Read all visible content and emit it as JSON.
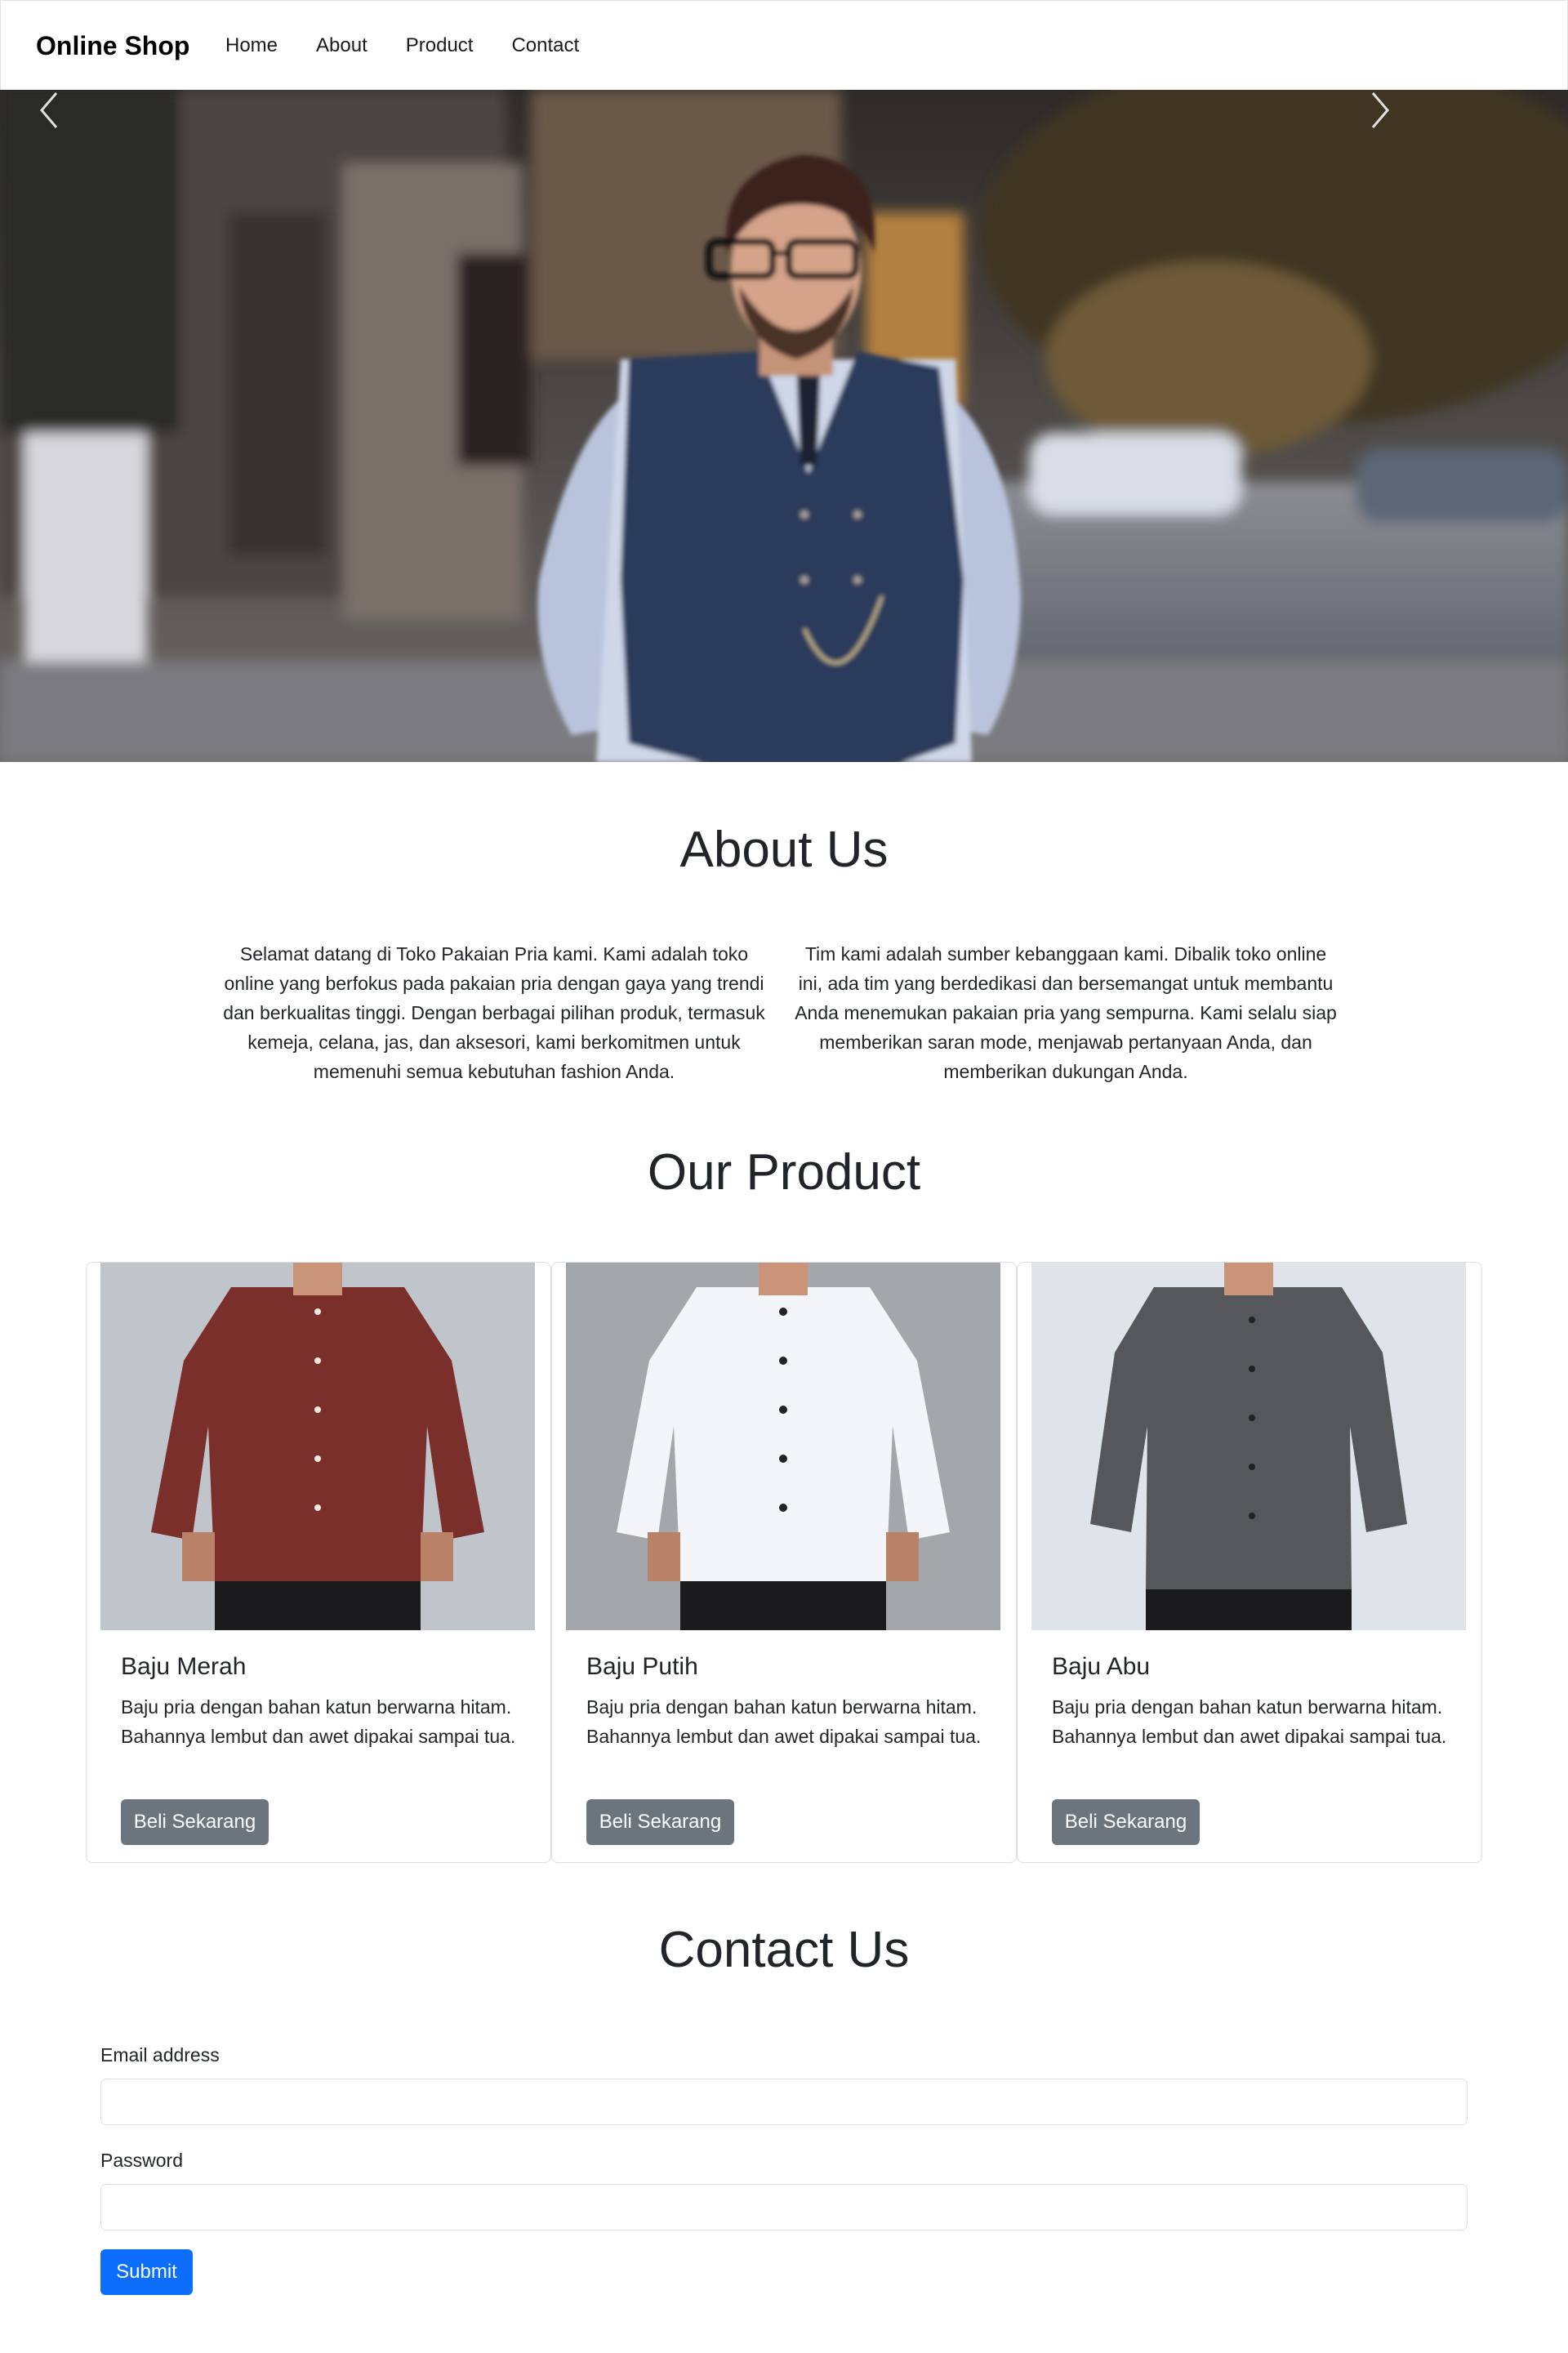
{
  "navbar": {
    "brand": "Online Shop",
    "links": [
      "Home",
      "About",
      "Product",
      "Contact"
    ]
  },
  "hero": {
    "image": "man-in-vest-street-photo",
    "prev_icon": "chevron-left-icon",
    "next_icon": "chevron-right-icon"
  },
  "about": {
    "title": "About Us",
    "paragraph_left": "Selamat datang di Toko Pakaian Pria kami. Kami adalah toko online yang berfokus pada pakaian pria dengan gaya yang trendi dan berkualitas tinggi. Dengan berbagai pilihan produk, termasuk kemeja, celana, jas, dan aksesori, kami berkomitmen untuk memenuhi semua kebutuhan fashion Anda.",
    "paragraph_right": "Tim kami adalah sumber kebanggaan kami. Dibalik toko online ini, ada tim yang berdedikasi dan bersemangat untuk membantu Anda menemukan pakaian pria yang sempurna. Kami selalu siap memberikan saran mode, menjawab pertanyaan Anda, dan memberikan dukungan Anda."
  },
  "products": {
    "title": "Our Product",
    "items": [
      {
        "name": "Baju Merah",
        "description": "Baju pria dengan bahan katun berwarna hitam. Bahannya lembut dan awet dipakai sampai tua.",
        "button": "Beli Sekarang",
        "shirt_color": "#7b2f2b"
      },
      {
        "name": "Baju Putih",
        "description": "Baju pria dengan bahan katun berwarna hitam. Bahannya lembut dan awet dipakai sampai tua.",
        "button": "Beli Sekarang",
        "shirt_color": "#f4f5f8"
      },
      {
        "name": "Baju Abu",
        "description": "Baju pria dengan bahan katun berwarna hitam. Bahannya lembut dan awet dipakai sampai tua.",
        "button": "Beli Sekarang",
        "shirt_color": "#55575b"
      }
    ]
  },
  "contact": {
    "title": "Contact Us",
    "email_label": "Email address",
    "email_value": "",
    "password_label": "Password",
    "password_value": "",
    "submit": "Submit"
  },
  "colors": {
    "primary": "#0d6efd",
    "secondary": "#6c757d"
  }
}
